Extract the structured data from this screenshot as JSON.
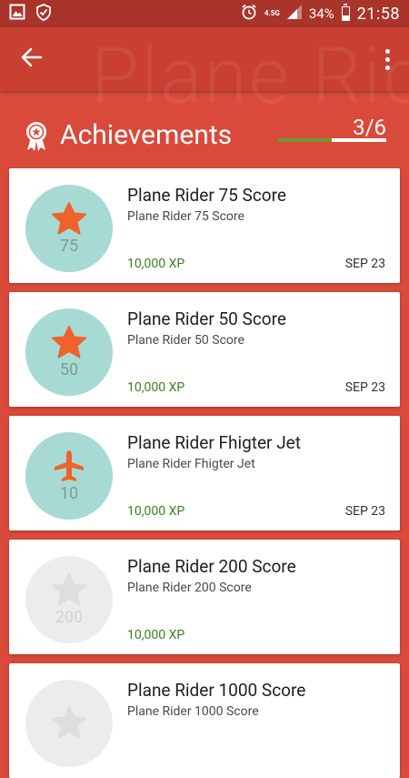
{
  "status_bar": {
    "network": "4.5G",
    "battery": "34%",
    "time": "21:58"
  },
  "app_bar": {
    "background_title": "Plane Rider"
  },
  "achievements": {
    "title": "Achievements",
    "progress_label": "3/6",
    "progress_fraction": 0.5,
    "accent_color": "#6a9a37"
  },
  "cards": [
    {
      "title": "Plane Rider 75 Score",
      "subtitle": "Plane Rider 75 Score",
      "badge_number": "75",
      "xp": "10,000 XP",
      "date": "SEP 23",
      "icon": "star-icon",
      "unlocked": true
    },
    {
      "title": "Plane Rider 50 Score",
      "subtitle": "Plane Rider 50 Score",
      "badge_number": "50",
      "xp": "10,000 XP",
      "date": "SEP 23",
      "icon": "star-icon",
      "unlocked": true
    },
    {
      "title": "Plane Rider Fhigter Jet",
      "subtitle": "Plane Rider Fhigter Jet",
      "badge_number": "10",
      "xp": "10,000 XP",
      "date": "SEP 23",
      "icon": "airplane-icon",
      "unlocked": true
    },
    {
      "title": "Plane Rider 200 Score",
      "subtitle": "Plane Rider 200 Score",
      "badge_number": "200",
      "xp": "10,000 XP",
      "date": "",
      "icon": "star-icon",
      "unlocked": false
    },
    {
      "title": "Plane Rider 1000 Score",
      "subtitle": "Plane Rider 1000 Score",
      "badge_number": "",
      "xp": "",
      "date": "",
      "icon": "star-icon",
      "unlocked": false
    }
  ],
  "colors": {
    "primary": "#d94a3b",
    "unlocked_badge": "#a6dad3",
    "locked_badge": "#ececec",
    "icon_orange": "#f0622b",
    "xp_green": "#3d7f1f"
  }
}
